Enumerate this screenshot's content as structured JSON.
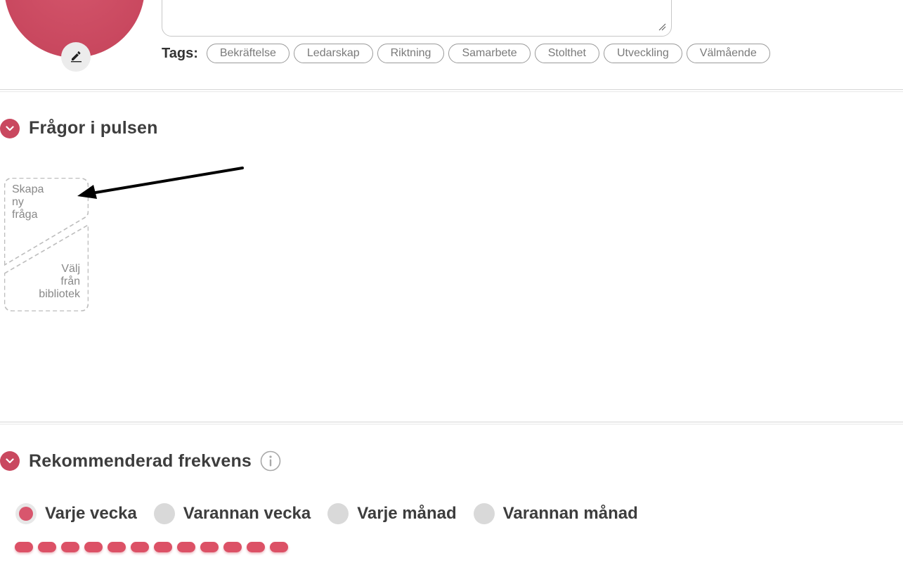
{
  "tags": {
    "label": "Tags:",
    "items": [
      "Bekräftelse",
      "Ledarskap",
      "Riktning",
      "Samarbete",
      "Stolthet",
      "Utveckling",
      "Välmående"
    ]
  },
  "questions_section": {
    "title": "Frågor i pulsen",
    "create_new_lines": [
      "Skapa",
      "ny",
      "fråga"
    ],
    "choose_library_lines": [
      "Välj",
      "från",
      "bibliotek"
    ]
  },
  "frequency_section": {
    "title": "Rekommenderad frekvens",
    "options": [
      {
        "label": "Varje vecka",
        "selected": true
      },
      {
        "label": "Varannan vecka",
        "selected": false
      },
      {
        "label": "Varje månad",
        "selected": false
      },
      {
        "label": "Varannan månad",
        "selected": false
      }
    ],
    "schedule_marker_count": 12
  },
  "icons": {
    "edit_avatar": "pencil-icon",
    "section_toggle": "chevron-down-icon",
    "info": "info-icon"
  },
  "colors": {
    "accent": "#c9485f",
    "pill": "#dc5166",
    "tag_border": "#9a9a9a",
    "divider": "#d6d6d6"
  }
}
